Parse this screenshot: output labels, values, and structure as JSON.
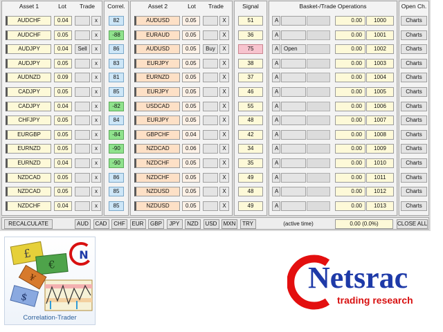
{
  "headers": {
    "asset1": "Asset 1",
    "lot1": "Lot",
    "trade1": "Trade",
    "correl": "Correl.",
    "asset2": "Asset 2",
    "lot2": "Lot",
    "trade2": "Trade",
    "signal": "Signal",
    "basket": "Basket-/Trade Operations",
    "opench": "Open Ch."
  },
  "rows": [
    {
      "a1": "AUDCHF",
      "l1": "0.04",
      "t1": "",
      "x1": "x",
      "corr": "82",
      "neg": false,
      "a2": "AUDUSD",
      "l2": "0.05",
      "t2": "",
      "x2": "X",
      "signal": "51",
      "hi": false,
      "a": "A",
      "op": "",
      "value": "0.00",
      "magic": "1000",
      "charts": "Charts"
    },
    {
      "a1": "AUDCHF",
      "l1": "0.05",
      "t1": "",
      "x1": "x",
      "corr": "-88",
      "neg": true,
      "a2": "EURAUD",
      "l2": "0.05",
      "t2": "",
      "x2": "X",
      "signal": "36",
      "hi": false,
      "a": "A",
      "op": "",
      "value": "0.00",
      "magic": "1001",
      "charts": "Charts"
    },
    {
      "a1": "AUDJPY",
      "l1": "0.04",
      "t1": "Sell",
      "x1": "x",
      "corr": "86",
      "neg": false,
      "a2": "AUDUSD",
      "l2": "0.05",
      "t2": "Buy",
      "x2": "X",
      "signal": "75",
      "hi": true,
      "a": "A",
      "op": "Open",
      "value": "0.00",
      "magic": "1002",
      "charts": "Charts"
    },
    {
      "a1": "AUDJPY",
      "l1": "0.05",
      "t1": "",
      "x1": "x",
      "corr": "83",
      "neg": false,
      "a2": "EURJPY",
      "l2": "0.05",
      "t2": "",
      "x2": "X",
      "signal": "38",
      "hi": false,
      "a": "A",
      "op": "",
      "value": "0.00",
      "magic": "1003",
      "charts": "Charts"
    },
    {
      "a1": "AUDNZD",
      "l1": "0.09",
      "t1": "",
      "x1": "x",
      "corr": "81",
      "neg": false,
      "a2": "EURNZD",
      "l2": "0.05",
      "t2": "",
      "x2": "X",
      "signal": "37",
      "hi": false,
      "a": "A",
      "op": "",
      "value": "0.00",
      "magic": "1004",
      "charts": "Charts"
    },
    {
      "a1": "CADJPY",
      "l1": "0.05",
      "t1": "",
      "x1": "x",
      "corr": "85",
      "neg": false,
      "a2": "EURJPY",
      "l2": "0.05",
      "t2": "",
      "x2": "X",
      "signal": "46",
      "hi": false,
      "a": "A",
      "op": "",
      "value": "0.00",
      "magic": "1005",
      "charts": "Charts"
    },
    {
      "a1": "CADJPY",
      "l1": "0.04",
      "t1": "",
      "x1": "x",
      "corr": "-82",
      "neg": true,
      "a2": "USDCAD",
      "l2": "0.05",
      "t2": "",
      "x2": "X",
      "signal": "55",
      "hi": false,
      "a": "A",
      "op": "",
      "value": "0.00",
      "magic": "1006",
      "charts": "Charts"
    },
    {
      "a1": "CHFJPY",
      "l1": "0.05",
      "t1": "",
      "x1": "x",
      "corr": "84",
      "neg": false,
      "a2": "EURJPY",
      "l2": "0.05",
      "t2": "",
      "x2": "X",
      "signal": "48",
      "hi": false,
      "a": "A",
      "op": "",
      "value": "0.00",
      "magic": "1007",
      "charts": "Charts"
    },
    {
      "a1": "EURGBP",
      "l1": "0.05",
      "t1": "",
      "x1": "x",
      "corr": "-84",
      "neg": true,
      "a2": "GBPCHF",
      "l2": "0.04",
      "t2": "",
      "x2": "X",
      "signal": "42",
      "hi": false,
      "a": "A",
      "op": "",
      "value": "0.00",
      "magic": "1008",
      "charts": "Charts"
    },
    {
      "a1": "EURNZD",
      "l1": "0.05",
      "t1": "",
      "x1": "x",
      "corr": "-90",
      "neg": true,
      "a2": "NZDCAD",
      "l2": "0.06",
      "t2": "",
      "x2": "X",
      "signal": "34",
      "hi": false,
      "a": "A",
      "op": "",
      "value": "0.00",
      "magic": "1009",
      "charts": "Charts"
    },
    {
      "a1": "EURNZD",
      "l1": "0.04",
      "t1": "",
      "x1": "x",
      "corr": "-90",
      "neg": true,
      "a2": "NZDCHF",
      "l2": "0.05",
      "t2": "",
      "x2": "X",
      "signal": "35",
      "hi": false,
      "a": "A",
      "op": "",
      "value": "0.00",
      "magic": "1010",
      "charts": "Charts"
    },
    {
      "a1": "NZDCAD",
      "l1": "0.05",
      "t1": "",
      "x1": "x",
      "corr": "86",
      "neg": false,
      "a2": "NZDCHF",
      "l2": "0.05",
      "t2": "",
      "x2": "X",
      "signal": "49",
      "hi": false,
      "a": "A",
      "op": "",
      "value": "0.00",
      "magic": "1011",
      "charts": "Charts"
    },
    {
      "a1": "NZDCAD",
      "l1": "0.05",
      "t1": "",
      "x1": "x",
      "corr": "85",
      "neg": false,
      "a2": "NZDUSD",
      "l2": "0.05",
      "t2": "",
      "x2": "X",
      "signal": "48",
      "hi": false,
      "a": "A",
      "op": "",
      "value": "0.00",
      "magic": "1012",
      "charts": "Charts"
    },
    {
      "a1": "NZDCHF",
      "l1": "0.04",
      "t1": "",
      "x1": "x",
      "corr": "85",
      "neg": false,
      "a2": "NZDUSD",
      "l2": "0.05",
      "t2": "",
      "x2": "X",
      "signal": "49",
      "hi": false,
      "a": "A",
      "op": "",
      "value": "0.00",
      "magic": "1013",
      "charts": "Charts"
    }
  ],
  "footer": {
    "recalculate": "RECALCULATE",
    "currencies": [
      "AUD",
      "CAD",
      "CHF",
      "EUR",
      "GBP",
      "JPY",
      "NZD",
      "USD",
      "MXN",
      "TRY"
    ],
    "active_time": "(active time)",
    "total": "0.00 (0.0%)",
    "close_all": "CLOSE ALL"
  },
  "branding": {
    "product_caption": "Correlation-Trader",
    "badge_letter": "N",
    "pound": "£",
    "euro": "€",
    "yen": "¥",
    "dollar": "$",
    "company": "Netsrac",
    "tagline": "trading research"
  },
  "colors": {
    "asset1_bg": "#fdf9d8",
    "asset2_bg": "#fde0c6",
    "corr_positive": "#cde6f7",
    "corr_negative": "#8fe28c",
    "signal_high": "#f7c3ce",
    "brand_blue": "#1e3aa8",
    "brand_red": "#d81010"
  }
}
